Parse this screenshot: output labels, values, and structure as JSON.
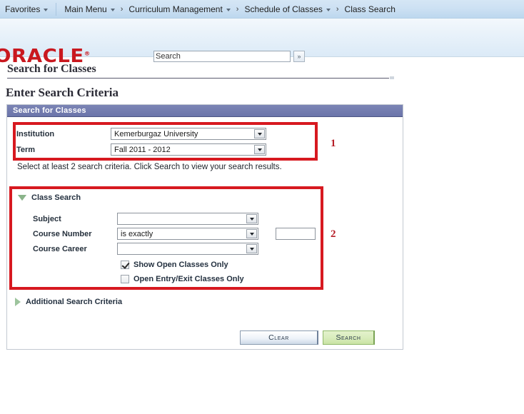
{
  "topnav": {
    "favorites": "Favorites",
    "main_menu": "Main Menu",
    "crumb_arrow": "›",
    "breadcrumbs": [
      {
        "label": "Curriculum Management",
        "has_caret": true
      },
      {
        "label": "Schedule of Classes",
        "has_caret": true
      },
      {
        "label": "Class Search",
        "has_caret": false
      }
    ]
  },
  "header": {
    "logo_text": "ORACLE",
    "logo_tm": "®",
    "search_value": "Search",
    "search_placeholder": "Search",
    "search_button_label": "»"
  },
  "page": {
    "title": "Search for Classes",
    "subtitle": "Enter Search Criteria",
    "panel_header": "Search for Classes",
    "note": "Select at least 2 search criteria. Click Search to view your search results."
  },
  "criteria": {
    "institution_label": "Institution",
    "institution_value": "Kemerburgaz University",
    "term_label": "Term",
    "term_value": "Fall 2011 - 2012"
  },
  "class_search": {
    "section_label": "Class Search",
    "subject_label": "Subject",
    "subject_value": "",
    "course_number_label": "Course Number",
    "course_number_operator": "is exactly",
    "course_number_value": "",
    "course_career_label": "Course Career",
    "course_career_value": "",
    "checkbox_open_classes": "Show Open Classes Only",
    "checkbox_open_classes_checked": true,
    "checkbox_open_entry_exit": "Open Entry/Exit Classes Only",
    "checkbox_open_entry_exit_checked": false
  },
  "additional": {
    "section_label": "Additional Search Criteria"
  },
  "actions": {
    "clear_label": "Clear",
    "search_label": "Search"
  },
  "annotations": {
    "one": "1",
    "two": "2",
    "color": "#d71920"
  },
  "colors": {
    "brand_red": "#c9181f",
    "panel_header_blue": "#6b75aa",
    "annotation_red": "#d71920",
    "search_button_green": "#d8ecbb"
  }
}
